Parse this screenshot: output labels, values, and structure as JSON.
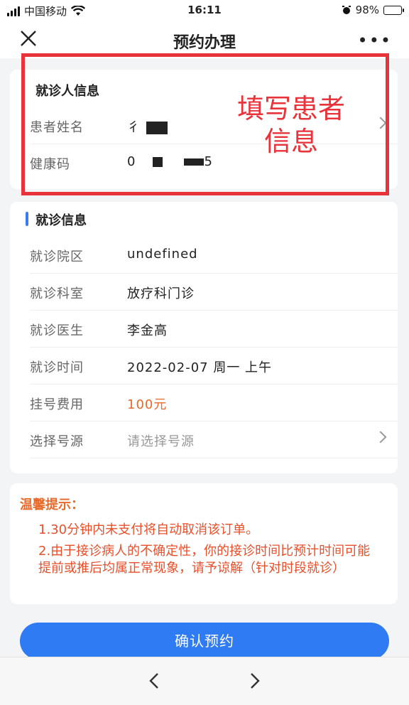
{
  "status_bar": {
    "carrier": "中国移动",
    "time": "16:11",
    "battery": "98%"
  },
  "nav": {
    "title": "预约办理"
  },
  "patient_info": {
    "title": "就诊人信息",
    "name_label": "患者姓名",
    "name_value_visible": "彳",
    "health_code_label": "健康码",
    "health_code_prefix": "0",
    "health_code_suffix": "5"
  },
  "annotation": {
    "line1": "填写患者",
    "line2": "信息"
  },
  "visit_info": {
    "title": "就诊信息",
    "rows": [
      {
        "label": "就诊院区",
        "value": "undefined"
      },
      {
        "label": "就诊科室",
        "value": "放疗科门诊"
      },
      {
        "label": "就诊医生",
        "value": "李金高"
      },
      {
        "label": "就诊时间",
        "value": "2022-02-07 周一 上午"
      },
      {
        "label": "挂号费用",
        "value": "100元"
      },
      {
        "label": "选择号源",
        "value": "请选择号源"
      }
    ]
  },
  "tips": {
    "title": "温馨提示：",
    "items": [
      "1.30分钟内未支付将自动取消该订单。",
      "2.由于接诊病人的不确定性，你的接诊时间比预计时间可能提前或推后均属正常现象，请予谅解（针对时段就诊）"
    ]
  },
  "confirm_button": "确认预约",
  "colors": {
    "accent": "#2f7bf3",
    "warning": "#e86a2b",
    "annotation": "#e8333b"
  }
}
